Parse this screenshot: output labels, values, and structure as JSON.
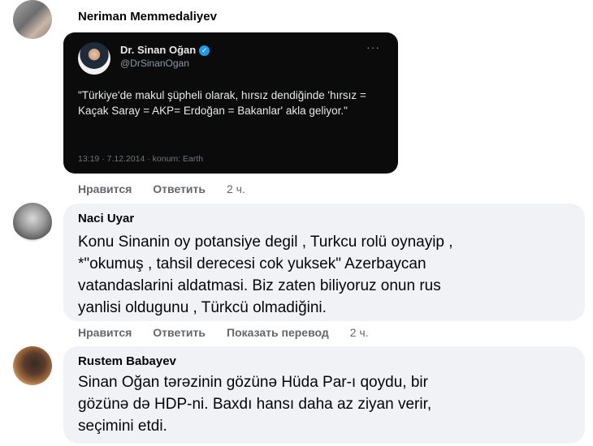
{
  "comments": [
    {
      "author": "Neriman Memmedaliyev",
      "tweet": {
        "name": "Dr. Sinan Oğan",
        "handle": "@DrSinanOgan",
        "text": "\"Türkiye'de makul şüpheli olarak, hırsız dendiğinde 'hırsız = Kaçak Saray = AKP= Erdoğan = Bakanlar' akla geliyor.\"",
        "meta": "13:19 · 7.12.2014 · konum: Earth",
        "more": "···"
      },
      "actions": {
        "like": "Нравится",
        "reply": "Ответить",
        "time": "2 ч."
      }
    },
    {
      "author": "Naci Uyar",
      "text": "Konu Sinanin oy potansiye degil , Turkcu rolü oynayip ,\n*\"okumuş , tahsil derecesi cok yuksek\" Azerbaycan\nvatandaslarini aldatmasi. Biz zaten biliyoruz onun rus\nyanlisi oldugunu , Türkcü olmadiğini.",
      "actions": {
        "like": "Нравится",
        "reply": "Ответить",
        "translate": "Показать перевод",
        "time": "2 ч."
      }
    },
    {
      "author": "Rustem Babayev",
      "text": "Sinan Oğan tərəzinin gözünə Hüda Par-ı qoydu, bir\ngözünə də HDP-ni. Baxdı hansı daha az ziyan verir,\nseçimini etdi."
    }
  ],
  "colors": {
    "bubble_bg": "#f0f2f5",
    "action_text": "#65676b",
    "tweet_bg": "#0b0b0b",
    "verified": "#1d9bf0"
  },
  "icons": {
    "verified": "verified-badge-icon",
    "more": "more-options-icon"
  }
}
